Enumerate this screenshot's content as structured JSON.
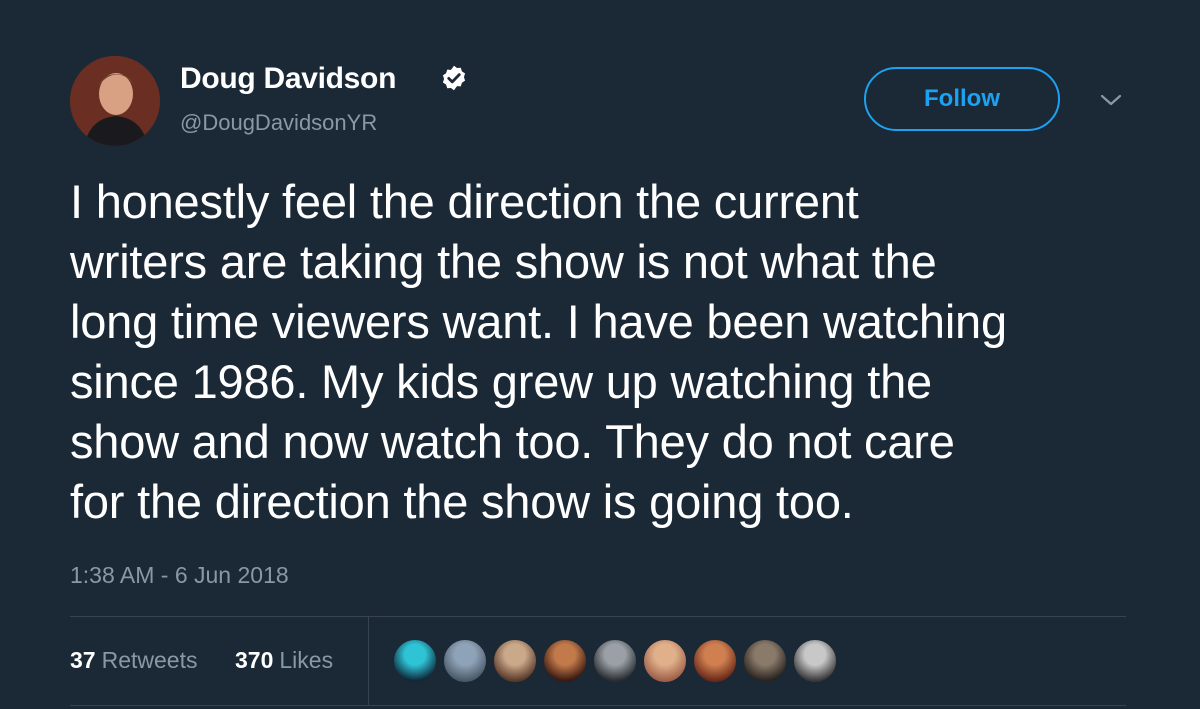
{
  "author": {
    "display_name": "Doug Davidson",
    "handle": "@DougDavidsonYR",
    "verified_icon": "verified-badge-icon"
  },
  "follow_button": {
    "label": "Follow"
  },
  "more_menu": {
    "icon": "chevron-down-icon"
  },
  "tweet": {
    "lines": [
      "I honestly feel the direction the current",
      "writers are taking the show is not what the",
      "long time viewers want. I have been watching",
      "since 1986. My kids grew up watching the",
      "show and now watch too. They do not care",
      "for the direction the show is going too."
    ],
    "timestamp": "1:38 AM - 6 Jun 2018"
  },
  "stats": {
    "retweets_count": "37",
    "retweets_label": "Retweets",
    "likes_count": "370",
    "likes_label": "Likes"
  },
  "liker_avatars": [
    {
      "colors": [
        "#2ec4d6",
        "#0f2a3a"
      ]
    },
    {
      "colors": [
        "#8fa3b8",
        "#4a5a68"
      ]
    },
    {
      "colors": [
        "#caa88a",
        "#5a3a2a"
      ]
    },
    {
      "colors": [
        "#c27a4a",
        "#3a1a12"
      ]
    },
    {
      "colors": [
        "#9aa0a6",
        "#2a2e33"
      ]
    },
    {
      "colors": [
        "#e0b08a",
        "#a0604a"
      ]
    },
    {
      "colors": [
        "#d08050",
        "#6a2a1a"
      ]
    },
    {
      "colors": [
        "#8a7a6a",
        "#2a2420"
      ]
    },
    {
      "colors": [
        "#c8c8c8",
        "#3a3a3a"
      ]
    }
  ],
  "colors": {
    "background": "#1b2836",
    "accent": "#1da1f2",
    "secondary_text": "#8899a6",
    "divider": "#38444d"
  }
}
